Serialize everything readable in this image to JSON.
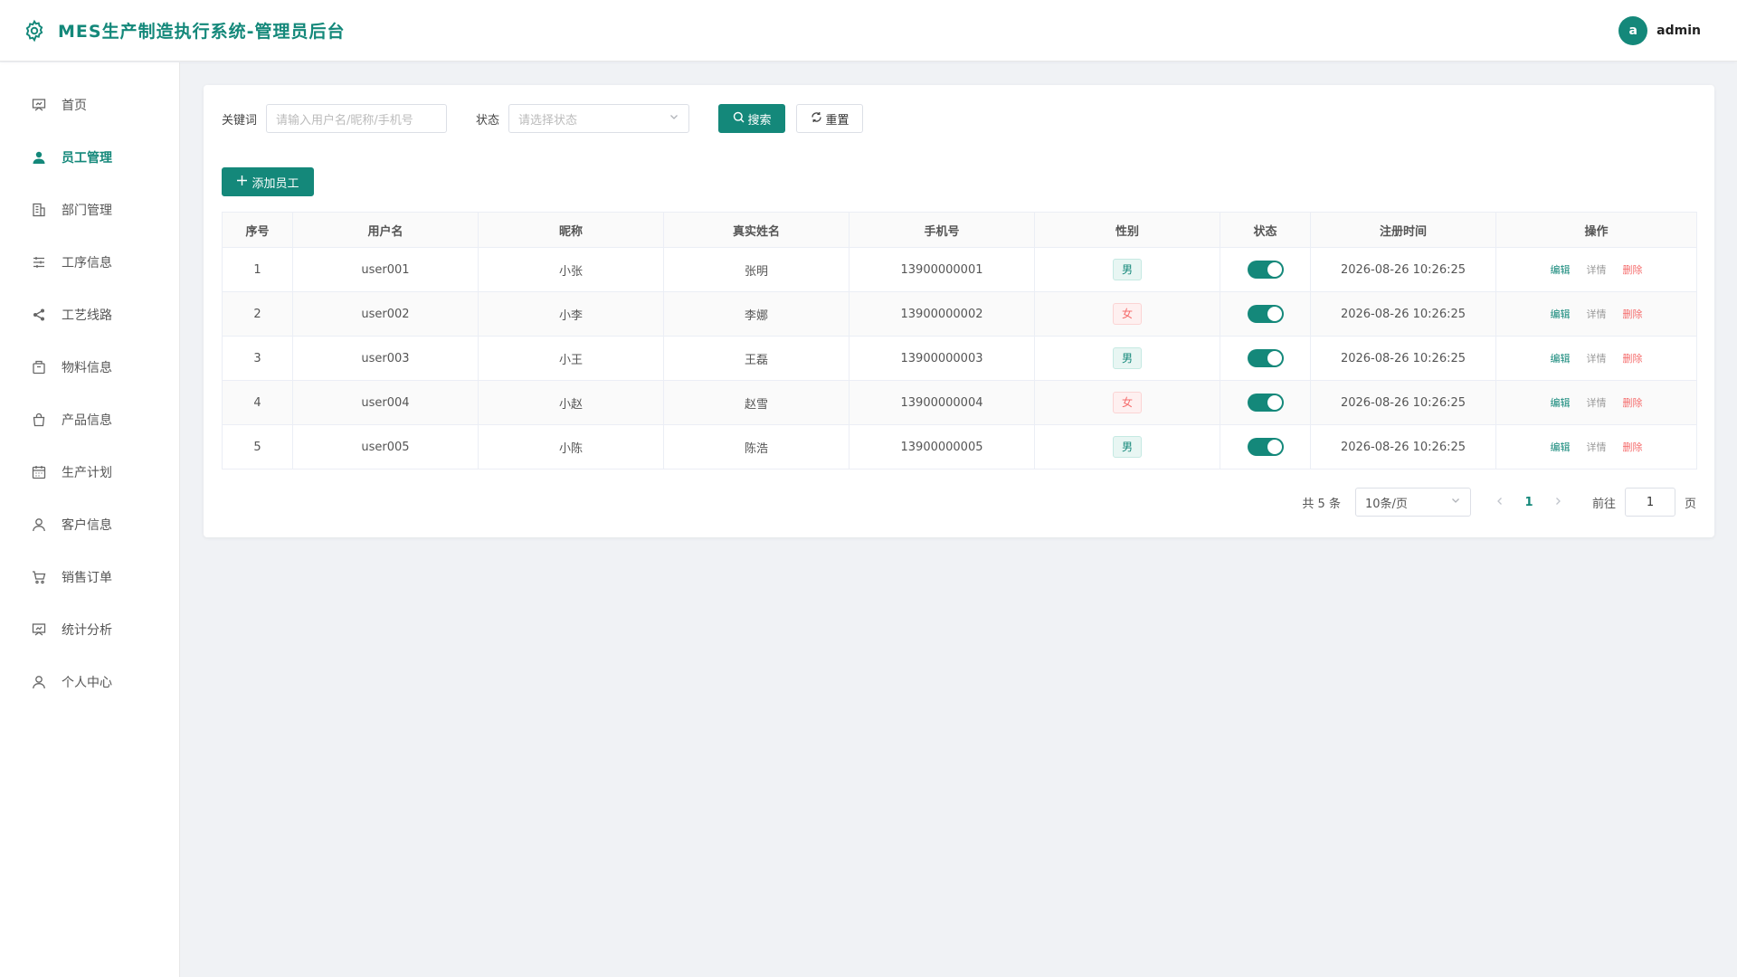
{
  "header": {
    "title": "MES生产制造执行系统-管理员后台",
    "avatar_letter": "a",
    "username": "admin"
  },
  "sidebar": {
    "items": [
      {
        "label": "首页",
        "icon": "dashboard-icon",
        "active": false
      },
      {
        "label": "员工管理",
        "icon": "user-filled-icon",
        "active": true
      },
      {
        "label": "部门管理",
        "icon": "building-icon",
        "active": false
      },
      {
        "label": "工序信息",
        "icon": "sliders-icon",
        "active": false
      },
      {
        "label": "工艺线路",
        "icon": "share-icon",
        "active": false
      },
      {
        "label": "物料信息",
        "icon": "box-icon",
        "active": false
      },
      {
        "label": "产品信息",
        "icon": "bag-icon",
        "active": false
      },
      {
        "label": "生产计划",
        "icon": "calendar-icon",
        "active": false
      },
      {
        "label": "客户信息",
        "icon": "user-icon",
        "active": false
      },
      {
        "label": "销售订单",
        "icon": "cart-icon",
        "active": false
      },
      {
        "label": "统计分析",
        "icon": "chart-board-icon",
        "active": false
      },
      {
        "label": "个人中心",
        "icon": "user-icon",
        "active": false
      }
    ]
  },
  "search": {
    "keyword_label": "关键词",
    "keyword_placeholder": "请输入用户名/昵称/手机号",
    "status_label": "状态",
    "status_placeholder": "请选择状态",
    "search_button": "搜索",
    "reset_button": "重置"
  },
  "toolbar": {
    "add_button": "添加员工"
  },
  "table": {
    "headers": [
      "序号",
      "用户名",
      "昵称",
      "真实姓名",
      "手机号",
      "性别",
      "状态",
      "注册时间",
      "操作"
    ],
    "rows": [
      {
        "index": "1",
        "username": "user001",
        "nickname": "小张",
        "realname": "张明",
        "phone": "13900000001",
        "gender": "男",
        "enabled": true,
        "registered": "2026-08-26 10:26:25"
      },
      {
        "index": "2",
        "username": "user002",
        "nickname": "小李",
        "realname": "李娜",
        "phone": "13900000002",
        "gender": "女",
        "enabled": true,
        "registered": "2026-08-26 10:26:25"
      },
      {
        "index": "3",
        "username": "user003",
        "nickname": "小王",
        "realname": "王磊",
        "phone": "13900000003",
        "gender": "男",
        "enabled": true,
        "registered": "2026-08-26 10:26:25"
      },
      {
        "index": "4",
        "username": "user004",
        "nickname": "小赵",
        "realname": "赵雪",
        "phone": "13900000004",
        "gender": "女",
        "enabled": true,
        "registered": "2026-08-26 10:26:25"
      },
      {
        "index": "5",
        "username": "user005",
        "nickname": "小陈",
        "realname": "陈浩",
        "phone": "13900000005",
        "gender": "男",
        "enabled": true,
        "registered": "2026-08-26 10:26:25"
      }
    ],
    "actions": {
      "edit": "编辑",
      "detail": "详情",
      "delete": "删除"
    }
  },
  "pagination": {
    "total": "共 5 条",
    "page_size": "10条/页",
    "current_page": "1",
    "goto_label": "前往",
    "goto_value": "1",
    "page_suffix": "页"
  },
  "colors": {
    "accent": "#14887a",
    "danger": "#f56c6c",
    "background": "#f0f2f5"
  }
}
